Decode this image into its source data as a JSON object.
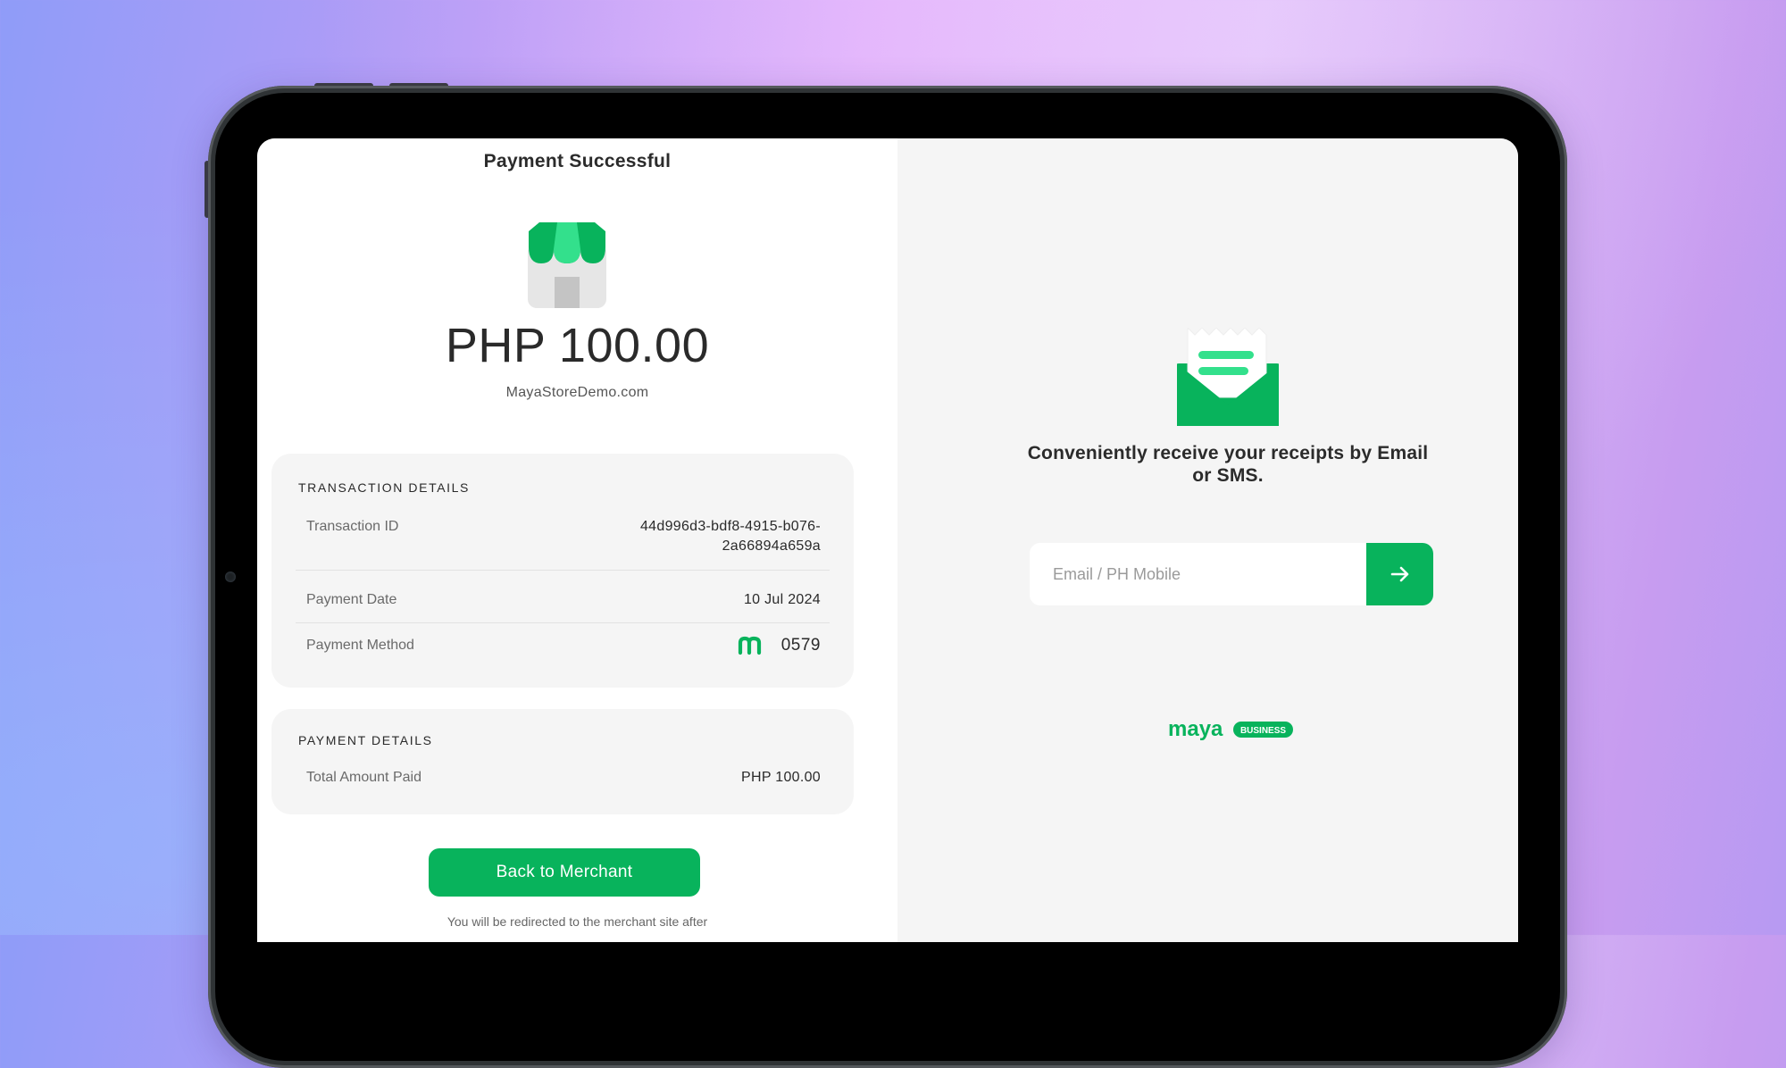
{
  "payment": {
    "title": "Payment Successful",
    "amount": "PHP 100.00",
    "merchant": "MayaStoreDemo.com"
  },
  "transaction_details": {
    "heading": "TRANSACTION DETAILS",
    "transaction_id_label": "Transaction ID",
    "transaction_id_line1": "44d996d3-bdf8-4915-b076-",
    "transaction_id_line2": "2a66894a659a",
    "payment_date_label": "Payment Date",
    "payment_date_value": "10 Jul 2024",
    "payment_method_label": "Payment Method",
    "payment_method_icon": "maya-m-icon",
    "payment_method_value": "0579"
  },
  "payment_details": {
    "heading": "PAYMENT DETAILS",
    "total_label": "Total Amount Paid",
    "total_value": "PHP 100.00"
  },
  "actions": {
    "back_button": "Back to Merchant",
    "redirect_note": "You will be redirected to the merchant site after"
  },
  "receipt": {
    "message": "Conveniently receive your receipts by Email or SMS.",
    "input_placeholder": "Email / PH Mobile",
    "submit_icon": "arrow-right-icon"
  },
  "brand": {
    "logo_word": "maya",
    "logo_badge": "BUSINESS",
    "accent": "#08b35c",
    "accent_light": "#33e08c"
  }
}
